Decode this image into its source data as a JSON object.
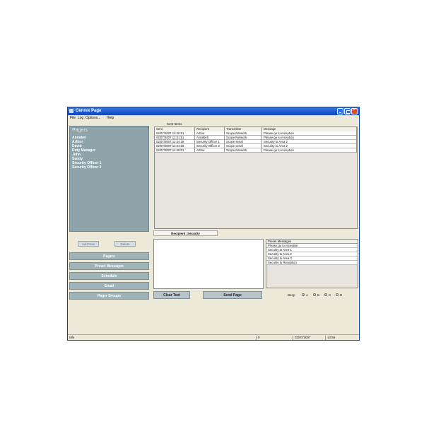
{
  "window": {
    "title": "Cenrex Page"
  },
  "menu": [
    "File",
    "Log",
    "Options...",
    "Help"
  ],
  "sent_items_label": "Sent Items",
  "pagers": {
    "header": "Pagers",
    "items": [
      "Annabel",
      "Arthur",
      "David",
      "Duty Manager",
      "John",
      "Sandy",
      "Security Officer 1",
      "Security Officer 2"
    ]
  },
  "pager_buttons": {
    "add": "Add New",
    "delete": "Delete"
  },
  "nav": [
    "Pagers",
    "Preset Messages",
    "Schedule",
    "Email",
    "Pager Groups"
  ],
  "sent_table": {
    "columns": [
      "Sent",
      "Recipient",
      "Transmitter",
      "Message"
    ],
    "rows": [
      [
        "02/07/2007 12:40:51",
        "Arthur",
        "Scope Network",
        "Please go to reception"
      ],
      [
        "02/07/2007 12:41:51",
        "Annabell",
        "Scope Network",
        "Please go to reception"
      ],
      [
        "02/07/2007 12:44:18",
        "Security Officer 1",
        "Scope serial",
        "Security to Area 2"
      ],
      [
        "02/07/2007 12:44:18",
        "Security Officer 2",
        "Scope serial",
        "Security to Area 2"
      ],
      [
        "02/07/2007 14:48:01",
        "Arthur",
        "Scope Network",
        "Please go to reception"
      ]
    ]
  },
  "recipient_label": "Recipient: Security",
  "message_text": "",
  "preset_messages": {
    "header": "Preset Messages",
    "items": [
      "Please go to reception",
      "Security to Area 1",
      "Security to Area 2",
      "Security to Area 3",
      "Security to Reception"
    ]
  },
  "actions": {
    "clear": "Clear Text",
    "send": "Send Page"
  },
  "beep": {
    "label": "Beep",
    "options": [
      "A",
      "B",
      "C",
      "D"
    ],
    "selected": "A"
  },
  "status": {
    "state": "Idle",
    "count": "0",
    "date": "02/07/2007",
    "time": "14:56"
  }
}
